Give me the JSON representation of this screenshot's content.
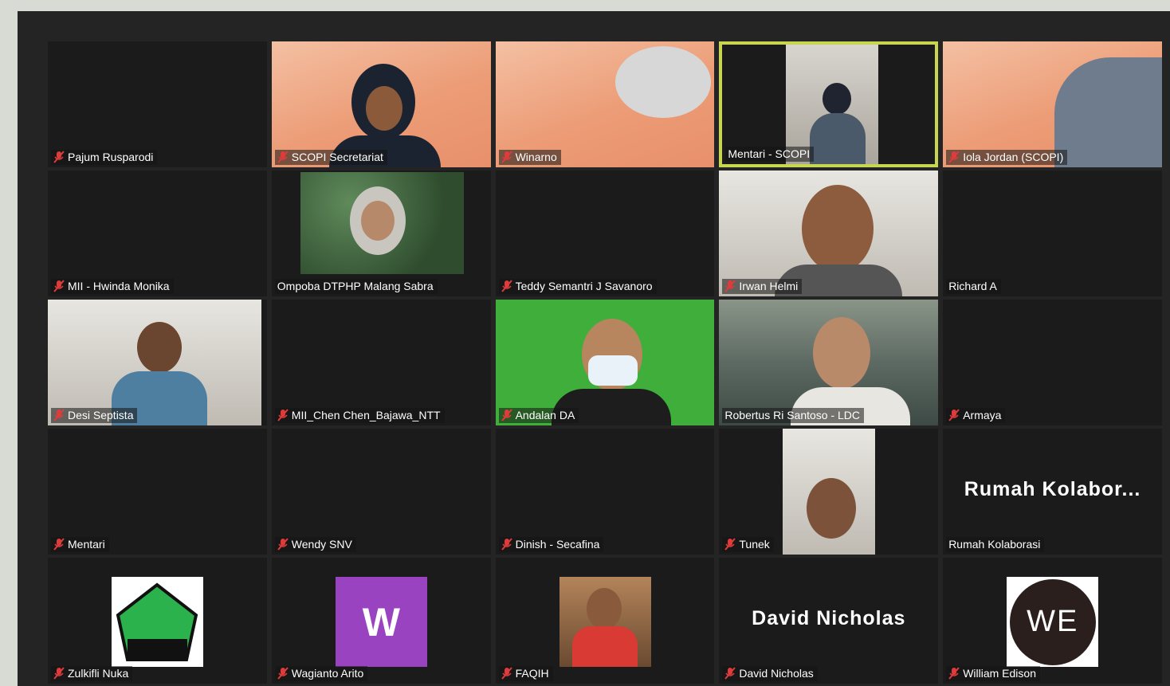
{
  "participants": [
    {
      "name": "Pajum Rusparodi",
      "muted": true
    },
    {
      "name": "SCOPI Secretariat",
      "muted": true
    },
    {
      "name": "Winarno",
      "muted": true
    },
    {
      "name": "Mentari - SCOPI",
      "muted": false,
      "active_speaker": true
    },
    {
      "name": "Iola Jordan (SCOPI)",
      "muted": true
    },
    {
      "name": "MII - Hwinda Monika",
      "muted": true
    },
    {
      "name": "Ompoba DTPHP Malang Sabra",
      "muted": false
    },
    {
      "name": "Teddy Semantri J Savanoro",
      "muted": true
    },
    {
      "name": "Irwan Helmi",
      "muted": true
    },
    {
      "name": "Richard A",
      "muted": false
    },
    {
      "name": "Desi Septista",
      "muted": true
    },
    {
      "name": "MII_Chen Chen_Bajawa_NTT",
      "muted": true
    },
    {
      "name": "Andalan DA",
      "muted": true
    },
    {
      "name": "Robertus Ri Santoso - LDC",
      "muted": false
    },
    {
      "name": "Armaya",
      "muted": true
    },
    {
      "name": "Mentari",
      "muted": true
    },
    {
      "name": "Wendy SNV",
      "muted": true
    },
    {
      "name": "Dinish - Secafina",
      "muted": true
    },
    {
      "name": "Tunek",
      "muted": true
    },
    {
      "name": "Rumah Kolaborasi",
      "muted": false,
      "display_text": "Rumah  Kolabor..."
    },
    {
      "name": "Zulkifli Nuka",
      "muted": true
    },
    {
      "name": "Wagianto Arito",
      "muted": true,
      "avatar_letter": "W"
    },
    {
      "name": "FAQIH",
      "muted": true
    },
    {
      "name": "David Nicholas",
      "muted": true,
      "display_text": "David Nicholas"
    },
    {
      "name": "William Edison",
      "muted": true,
      "logo_text": "WE"
    }
  ],
  "colors": {
    "active_border": "#c8d64f",
    "muted_icon": "#e03b3b",
    "tile_bg": "#1b1b1b",
    "frame_bg": "#242424",
    "avatar_purple": "#9a43c0"
  }
}
